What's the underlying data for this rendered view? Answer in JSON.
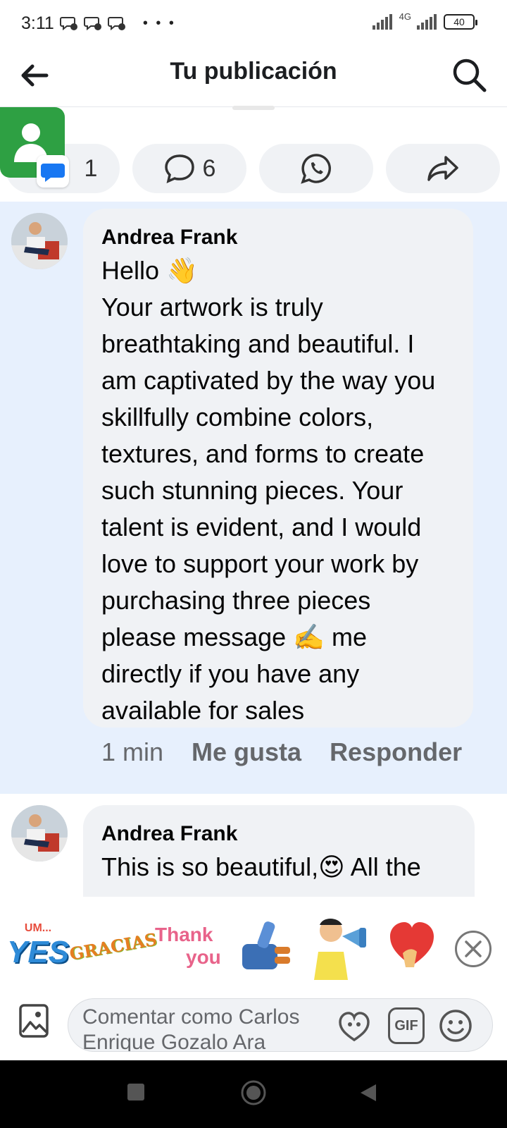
{
  "status_bar": {
    "time": "3:11",
    "dots": "• • •",
    "network": "4G",
    "battery": "40"
  },
  "header": {
    "title": "Tu publicación"
  },
  "actions": {
    "messenger_count": "1",
    "comments_count": "6"
  },
  "comments": [
    {
      "author": "Andrea Frank",
      "text": "Hello 👋\nYour artwork is truly\nbreathtaking and beautiful. I\nam captivated by the way you\nskillfully combine colors,\ntextures, and forms to create\nsuch stunning pieces. Your\ntalent is evident, and I would\nlove to support your work by\npurchasing three pieces\nplease message ✍️ me\ndirectly if you have any\navailable for sales",
      "time": "1 min",
      "like_label": "Me gusta",
      "reply_label": "Responder"
    },
    {
      "author": "Andrea Frank",
      "text": "This is so beautiful,😍 All the"
    }
  ],
  "stickers": {
    "yes_small": "UM...",
    "yes_big": "YES",
    "gracias": "GRACIAS",
    "thank": "Thank",
    "you": "you"
  },
  "composer": {
    "placeholder": "Comentar como Carlos Enrique Gozalo Ara",
    "gif_label": "GIF"
  },
  "colors": {
    "highlight_bg": "#e7f0fd",
    "bubble_bg": "#f0f2f5",
    "meta_text": "#65676b",
    "app_green": "#2ea043",
    "messenger_blue": "#1877f2"
  }
}
